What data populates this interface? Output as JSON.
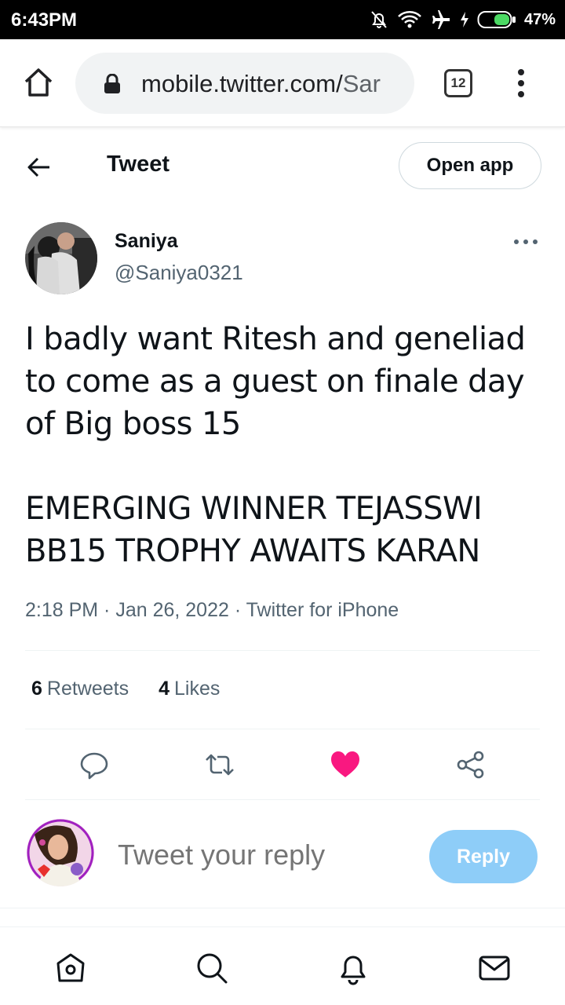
{
  "status_bar": {
    "time": "6:43PM",
    "battery": "47%",
    "icons": [
      "bell-off-icon",
      "wifi-icon",
      "airplane-icon",
      "charging-icon",
      "battery-icon"
    ]
  },
  "browser": {
    "url_main": "mobile.twitter.com/",
    "url_faded": "Sar",
    "tab_count": "12",
    "icons": [
      "home-icon",
      "lock-icon",
      "kebab-menu-icon"
    ]
  },
  "header": {
    "title": "Tweet",
    "open_app": "Open app"
  },
  "tweet": {
    "author_name": "Saniya",
    "author_handle": "@Saniya0321",
    "paragraph1": "I badly want Ritesh and geneliad to come as a guest on finale day of Big boss 15",
    "paragraph2": "EMERGING WINNER TEJASSWI BB15 TROPHY AWAITS KARAN",
    "meta": "2:18 PM · Jan 26, 2022 · Twitter for iPhone",
    "retweets_count": "6",
    "retweets_label": "Retweets",
    "likes_count": "4",
    "likes_label": "Likes",
    "liked": true
  },
  "reply": {
    "placeholder": "Tweet your reply",
    "button": "Reply"
  },
  "colors": {
    "accent": "#1d9bf0",
    "reply_button": "#8ecdf8",
    "like": "#f91880",
    "secondary_text": "#536471"
  }
}
